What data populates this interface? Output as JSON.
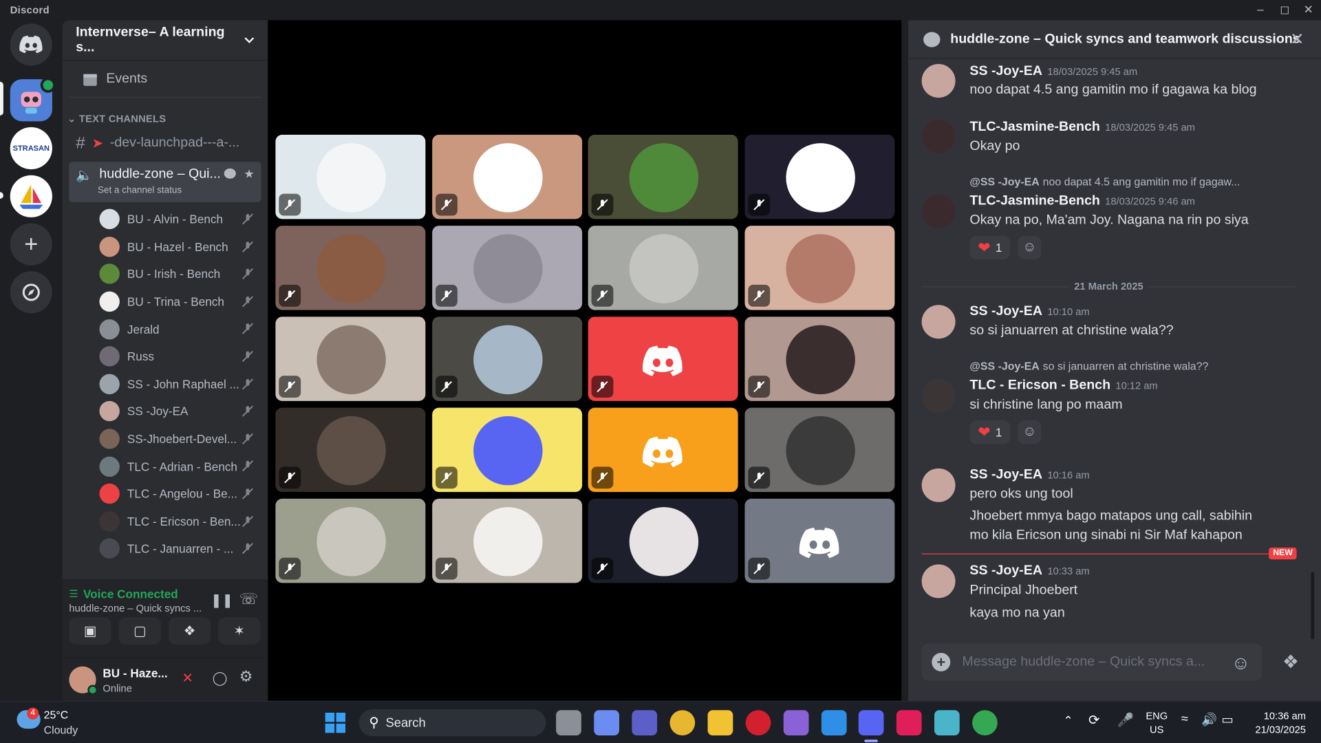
{
  "app": {
    "name": "Discord"
  },
  "server": {
    "name": "Internverse– A learning s..."
  },
  "sidebar": {
    "events_label": "Events",
    "category": "TEXT CHANNELS",
    "channel_text": "-dev-launchpad---a-...",
    "channel_voice": "huddle-zone – Qui...",
    "channel_status_hint": "Set a channel status",
    "members": [
      {
        "name": "BU - Alvin - Bench",
        "color": "#d8dde3"
      },
      {
        "name": "BU - Hazel - Bench",
        "color": "#c99580"
      },
      {
        "name": "BU - Irish - Bench",
        "color": "#5c8a3a"
      },
      {
        "name": "BU - Trina - Bench",
        "color": "#f1eeee"
      },
      {
        "name": "Jerald",
        "color": "#8a8f96"
      },
      {
        "name": "Russ",
        "color": "#6f6a74"
      },
      {
        "name": "SS - John Raphael ...",
        "color": "#9da3aa"
      },
      {
        "name": "SS -Joy-EA",
        "color": "#c7a6a0"
      },
      {
        "name": "SS-Jhoebert-Devel...",
        "color": "#7a6357"
      },
      {
        "name": "TLC - Adrian - Bench",
        "color": "#6c7a80"
      },
      {
        "name": "TLC - Angelou - Be...",
        "color": "#ed4245"
      },
      {
        "name": "TLC - Ericson - Ben...",
        "color": "#3b3536"
      },
      {
        "name": "TLC - Januarren - ...",
        "color": "#4a4b52"
      }
    ]
  },
  "voice": {
    "status": "Voice Connected",
    "channel": "huddle-zone – Quick syncs ..."
  },
  "user": {
    "name": "BU - Haze...",
    "status": "Online"
  },
  "stage": {
    "tiles": [
      {
        "bg": "#dfe8ec",
        "face": "#f3f5f6"
      },
      {
        "bg": "#c9987f",
        "face": "#ffffff"
      },
      {
        "bg": "#4a4e36",
        "face": "#4f8a3b"
      },
      {
        "bg": "#211f2f",
        "face": "#ffffff"
      },
      {
        "bg": "#7e625c",
        "face": "#8a5c44"
      },
      {
        "bg": "#aba8b3",
        "face": "#8f8c98"
      },
      {
        "bg": "#a7aaa4",
        "face": "#c3c3c0"
      },
      {
        "bg": "#d8b2a1",
        "face": "#b47a6a"
      },
      {
        "bg": "#cbc0b6",
        "face": "#8b7b70"
      },
      {
        "bg": "#4b4a45",
        "face": "#a6b8c8"
      },
      {
        "bg": "#ee4245",
        "face": "discord"
      },
      {
        "bg": "#b19890",
        "face": "#3a2e2e"
      },
      {
        "bg": "#332d2a",
        "face": "#5d4e46"
      },
      {
        "bg": "#f6e46b",
        "face": "#5865f2"
      },
      {
        "bg": "#f8a01c",
        "face": "discord"
      },
      {
        "bg": "#6d6c6a",
        "face": "#3b3b3b"
      },
      {
        "bg": "#9c9e8e",
        "face": "#c9c7bd"
      },
      {
        "bg": "#bcb6ad",
        "face": "#f1efeb"
      },
      {
        "bg": "#1e1f2d",
        "face": "#e7e2e4"
      },
      {
        "bg": "#737a86",
        "face": "discord"
      }
    ]
  },
  "chat": {
    "title": "huddle-zone – Quick syncs and teamwork discussions",
    "messages": [
      {
        "name": "SS -Joy-EA",
        "time": "18/03/2025 9:45 am",
        "text": "noo dapat 4.5 ang gamitin mo if gagawa ka blog"
      },
      {
        "name": "TLC-Jasmine-Bench",
        "time": "18/03/2025 9:45 am",
        "text": "Okay po"
      },
      {
        "reply_name": "@SS -Joy-EA",
        "reply_text": "noo dapat 4.5 ang gamitin mo if gagaw...",
        "name": "TLC-Jasmine-Bench",
        "time": "18/03/2025 9:46 am",
        "text": "Okay na po, Ma'am Joy. Nagana na rin po siya",
        "reaction_count": "1"
      },
      {
        "date_divider": "21 March 2025"
      },
      {
        "name": "SS -Joy-EA",
        "time": "10:10 am",
        "text": "so si januarren at christine wala??"
      },
      {
        "reply_name": "@SS -Joy-EA",
        "reply_text": "so si januarren at christine wala??",
        "name": "TLC - Ericson - Bench",
        "time": "10:12 am",
        "text": "si  christine lang po maam",
        "reaction_count": "1"
      },
      {
        "name": "SS -Joy-EA",
        "time": "10:16 am",
        "text": "pero oks ung tool",
        "text2": "Jhoebert mmya bago matapos ung call, sabihin",
        "text3": "mo kila Ericson ung sinabi ni Sir Maf kahapon"
      },
      {
        "new_label": "NEW"
      },
      {
        "name": "SS -Joy-EA",
        "time": "10:33 am",
        "text": "Principal Jhoebert",
        "text2": "kaya mo na yan"
      }
    ],
    "composer_placeholder": "Message huddle-zone – Quick syncs a..."
  },
  "taskbar": {
    "weather_temp": "25°C",
    "weather_desc": "Cloudy",
    "weather_badge": "4",
    "search_label": "Search",
    "lang1": "ENG",
    "lang2": "US",
    "time": "10:36 am",
    "date": "21/03/2025"
  },
  "colors": {
    "accent": "#5865f2",
    "green": "#23a55a",
    "red": "#f23f43",
    "bg_dark": "#1e1f22"
  }
}
